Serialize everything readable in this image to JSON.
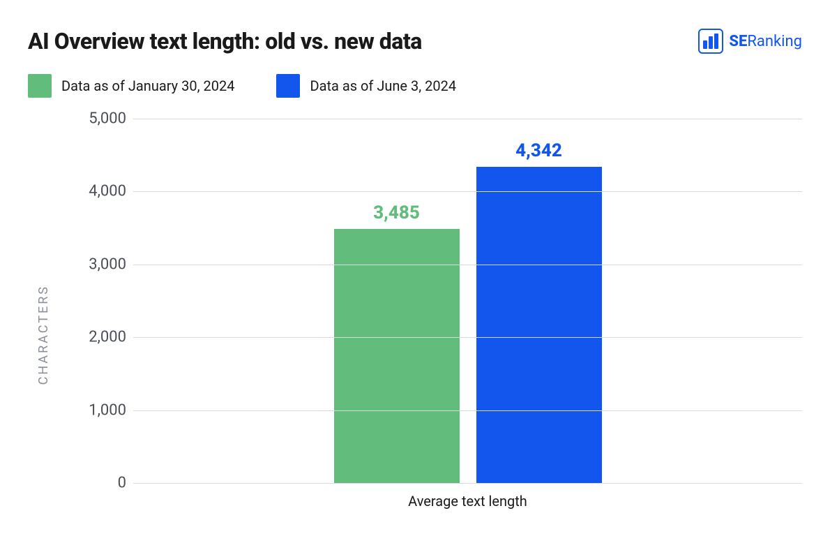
{
  "title": "AI Overview text length: old vs. new data",
  "brand": {
    "bold": "SE",
    "rest": "Ranking"
  },
  "legend": [
    {
      "label": "Data as of January 30, 2024",
      "color": "#62bd7d"
    },
    {
      "label": "Data as of June 3, 2024",
      "color": "#1356ee"
    }
  ],
  "ylabel": "CHARACTERS",
  "xlabel": "Average text length",
  "chart_data": {
    "type": "bar",
    "categories": [
      "Average text length"
    ],
    "series": [
      {
        "name": "Data as of January 30, 2024",
        "values": [
          3485
        ],
        "color": "#62bd7d"
      },
      {
        "name": "Data as of June 3, 2024",
        "values": [
          4342
        ],
        "color": "#1356ee"
      }
    ],
    "title": "AI Overview text length: old vs. new data",
    "xlabel": "Average text length",
    "ylabel": "CHARACTERS",
    "ylim": [
      0,
      5000
    ],
    "y_ticks": [
      0,
      1000,
      2000,
      3000,
      4000,
      5000
    ],
    "y_tick_labels": [
      "0",
      "1,000",
      "2,000",
      "3,000",
      "4,000",
      "5,000"
    ],
    "data_labels": [
      "3,485",
      "4,342"
    ]
  }
}
